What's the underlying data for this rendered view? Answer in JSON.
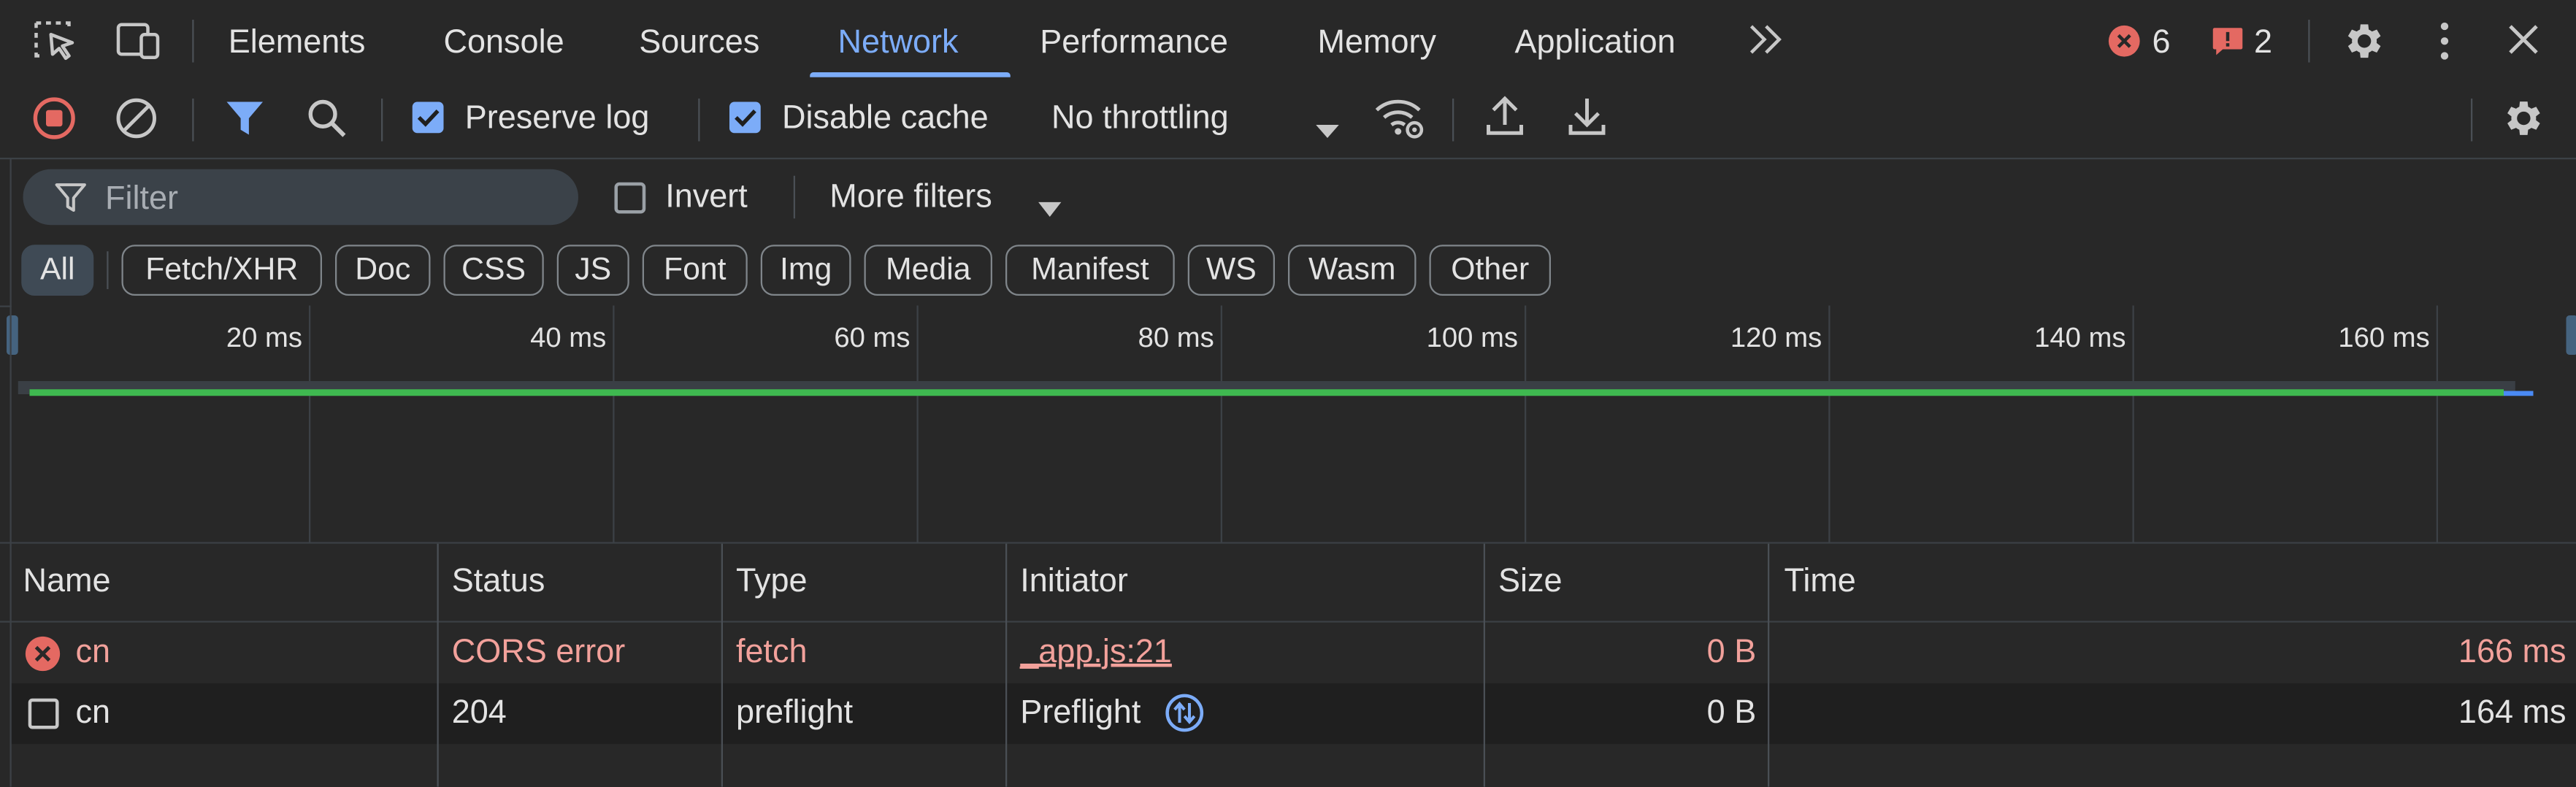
{
  "tabs": [
    {
      "label": "Elements"
    },
    {
      "label": "Console"
    },
    {
      "label": "Sources"
    },
    {
      "label": "Network"
    },
    {
      "label": "Performance"
    },
    {
      "label": "Memory"
    },
    {
      "label": "Application"
    }
  ],
  "counters": {
    "errors": "6",
    "warnings": "2"
  },
  "toolbar": {
    "preserve_log": {
      "label": "Preserve log",
      "checked": true
    },
    "disable_cache": {
      "label": "Disable cache",
      "checked": true
    },
    "throttling": "No throttling"
  },
  "filter": {
    "placeholder": "Filter",
    "invert_label": "Invert",
    "more_filters": "More filters"
  },
  "type_filters": [
    "All",
    "Fetch/XHR",
    "Doc",
    "CSS",
    "JS",
    "Font",
    "Img",
    "Media",
    "Manifest",
    "WS",
    "Wasm",
    "Other"
  ],
  "overview": {
    "ticks": [
      "20 ms",
      "40 ms",
      "60 ms",
      "80 ms",
      "100 ms",
      "120 ms",
      "140 ms",
      "160 ms"
    ]
  },
  "table": {
    "columns": [
      "Name",
      "Status",
      "Type",
      "Initiator",
      "Size",
      "Time"
    ],
    "rows": [
      {
        "name": "cn",
        "status": "CORS error",
        "type": "fetch",
        "initiator": "_app.js:21",
        "size": "0 B",
        "time": "166 ms",
        "error": true
      },
      {
        "name": "cn",
        "status": "204",
        "type": "preflight",
        "initiator": "Preflight",
        "size": "0 B",
        "time": "164 ms",
        "error": false
      }
    ]
  },
  "colors": {
    "accent": "#7cacf8",
    "error": "#f2a19b",
    "error_icon": "#e46962",
    "bar_green": "#3fb950",
    "bar_blue": "#4a8af4"
  }
}
